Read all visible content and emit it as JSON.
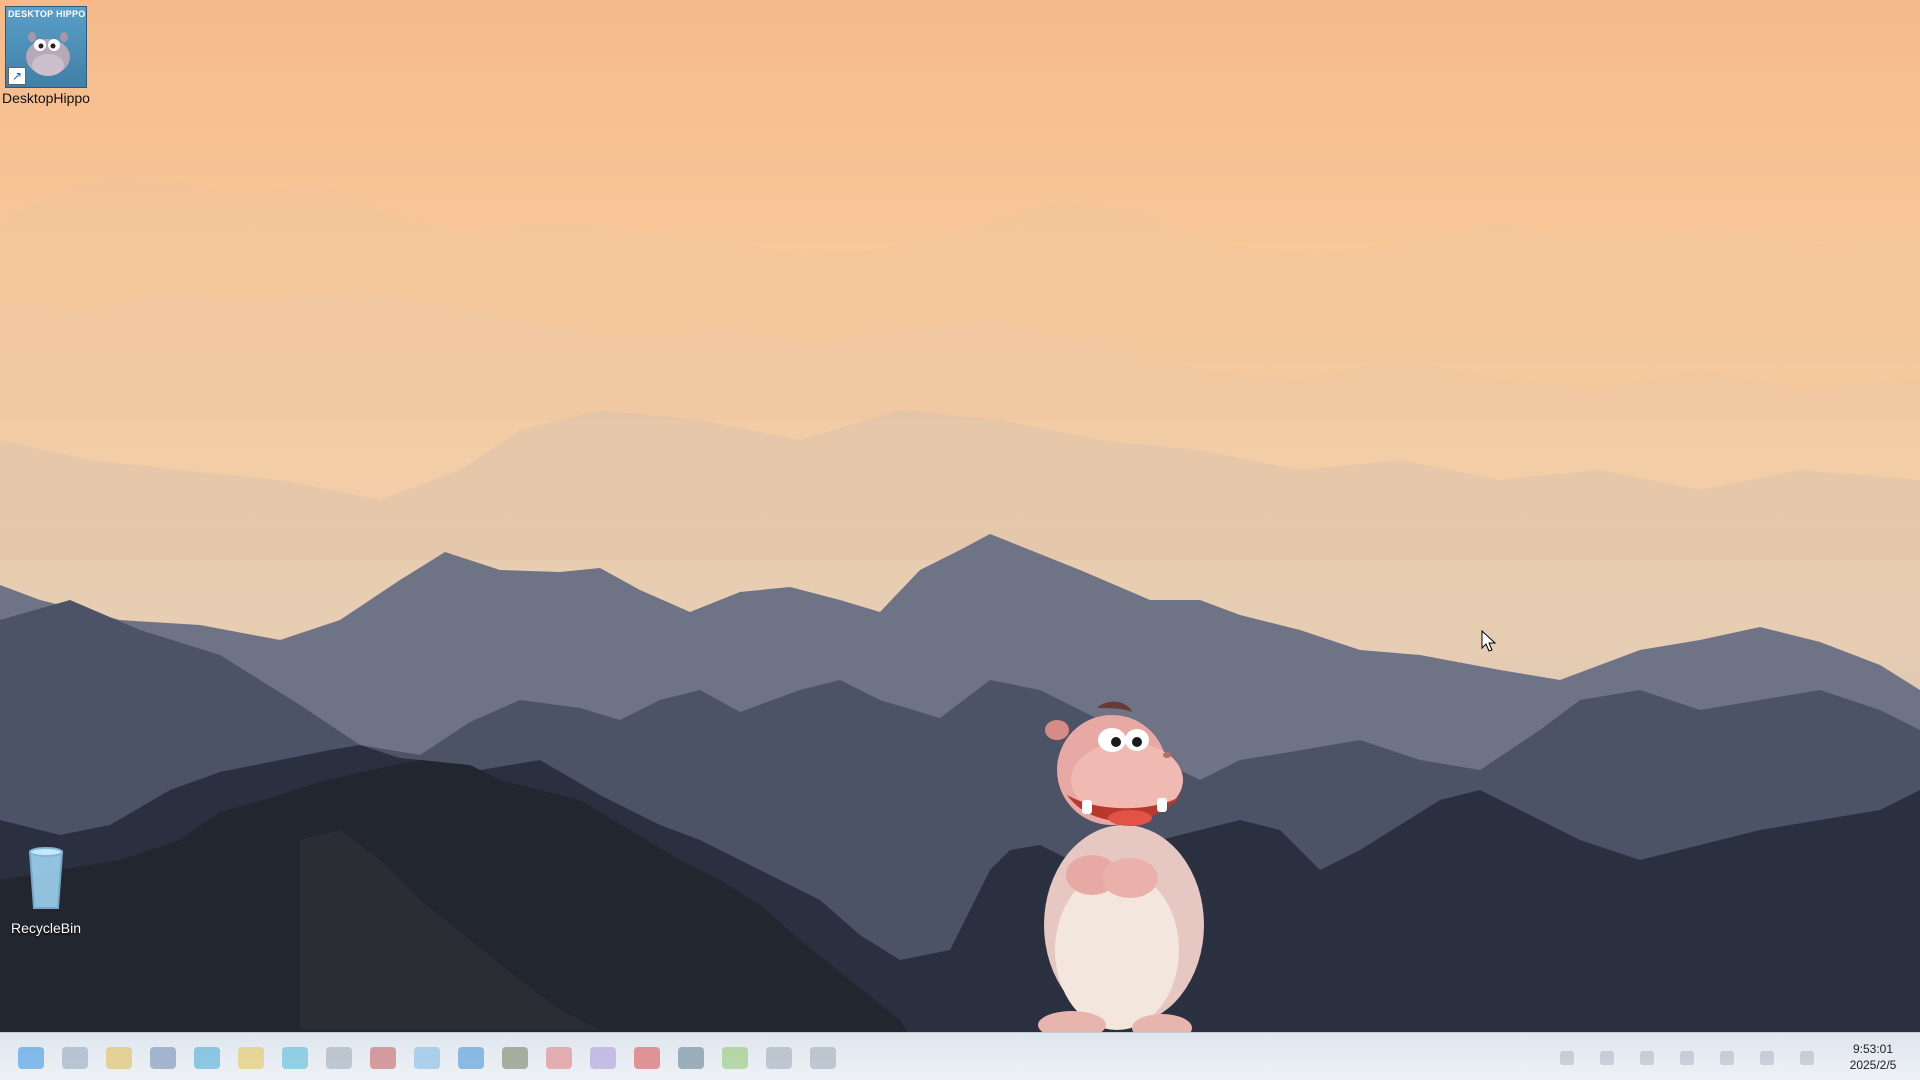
{
  "desktop": {
    "icons": [
      {
        "label": "DesktopHippo",
        "art_text": "DESKTOP HIPPO",
        "icon": "desktop-hippo-app-icon"
      },
      {
        "label": "RecycleBin",
        "icon": "recycle-bin-icon"
      }
    ]
  },
  "taskbar": {
    "apps": [
      {
        "icon": "start-icon",
        "color": "#2d8fe0"
      },
      {
        "icon": "search-icon",
        "color": "#8fa3b8"
      },
      {
        "icon": "chrome-icon",
        "color": "#e0b94c"
      },
      {
        "icon": "app-icon",
        "color": "#6c86b0"
      },
      {
        "icon": "app-icon",
        "color": "#3fa7d6"
      },
      {
        "icon": "folder-icon",
        "color": "#e6c24d"
      },
      {
        "icon": "app-icon",
        "color": "#4bb6d8"
      },
      {
        "icon": "app-icon",
        "color": "#9aa7b5"
      },
      {
        "icon": "app-icon",
        "color": "#c45858"
      },
      {
        "icon": "app-icon",
        "color": "#7ab8e6"
      },
      {
        "icon": "app-icon",
        "color": "#3c8fd6"
      },
      {
        "icon": "app-icon",
        "color": "#6d7a5a"
      },
      {
        "icon": "app-icon",
        "color": "#e07a7a"
      },
      {
        "icon": "app-icon",
        "color": "#a996d8"
      },
      {
        "icon": "app-icon",
        "color": "#d84a4a"
      },
      {
        "icon": "app-icon",
        "color": "#5b7a8c"
      },
      {
        "icon": "app-icon",
        "color": "#8cc46a"
      },
      {
        "icon": "app-icon",
        "color": "#9aa7b5"
      },
      {
        "icon": "app-icon",
        "color": "#9aa7b5"
      }
    ],
    "clock": {
      "time": "9:53:01",
      "date": "2025/2/5"
    }
  }
}
